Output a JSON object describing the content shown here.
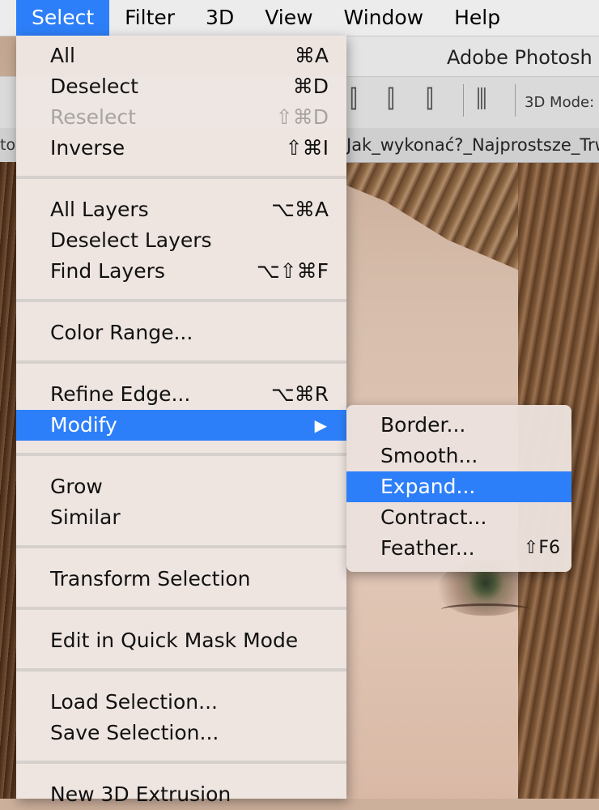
{
  "menubar": {
    "items": [
      {
        "label": "Select",
        "active": true
      },
      {
        "label": "Filter"
      },
      {
        "label": "3D"
      },
      {
        "label": "View"
      },
      {
        "label": "Window"
      },
      {
        "label": "Help"
      }
    ]
  },
  "app": {
    "title": "Adobe Photosh",
    "options_label": "3D Mode:",
    "document_tab": "Jak_wykonać?_Najprostsze_Trw",
    "document_tab_left": "tov"
  },
  "select_menu": {
    "groups": [
      [
        {
          "label": "All",
          "shortcut": "⌘A"
        },
        {
          "label": "Deselect",
          "shortcut": "⌘D"
        },
        {
          "label": "Reselect",
          "shortcut": "⇧⌘D",
          "disabled": true
        },
        {
          "label": "Inverse",
          "shortcut": "⇧⌘I"
        }
      ],
      [
        {
          "label": "All Layers",
          "shortcut": "⌥⌘A"
        },
        {
          "label": "Deselect Layers",
          "shortcut": ""
        },
        {
          "label": "Find Layers",
          "shortcut": "⌥⇧⌘F"
        }
      ],
      [
        {
          "label": "Color Range...",
          "shortcut": ""
        }
      ],
      [
        {
          "label": "Refine Edge...",
          "shortcut": "⌥⌘R"
        },
        {
          "label": "Modify",
          "shortcut": "",
          "submenu": true,
          "highlighted": true
        }
      ],
      [
        {
          "label": "Grow",
          "shortcut": ""
        },
        {
          "label": "Similar",
          "shortcut": ""
        }
      ],
      [
        {
          "label": "Transform Selection",
          "shortcut": ""
        }
      ],
      [
        {
          "label": "Edit in Quick Mask Mode",
          "shortcut": ""
        }
      ],
      [
        {
          "label": "Load Selection...",
          "shortcut": ""
        },
        {
          "label": "Save Selection...",
          "shortcut": ""
        }
      ],
      [
        {
          "label": "New 3D Extrusion",
          "shortcut": ""
        }
      ]
    ],
    "submenu_arrow": "▶"
  },
  "modify_submenu": {
    "items": [
      {
        "label": "Border...",
        "shortcut": ""
      },
      {
        "label": "Smooth...",
        "shortcut": ""
      },
      {
        "label": "Expand...",
        "shortcut": "",
        "highlighted": true
      },
      {
        "label": "Contract...",
        "shortcut": ""
      },
      {
        "label": "Feather...",
        "shortcut": "⇧F6"
      }
    ]
  },
  "colors": {
    "highlight": "#2d7ff9",
    "menu_bg": "#eee6e2",
    "disabled_text": "#a8a4a2"
  }
}
